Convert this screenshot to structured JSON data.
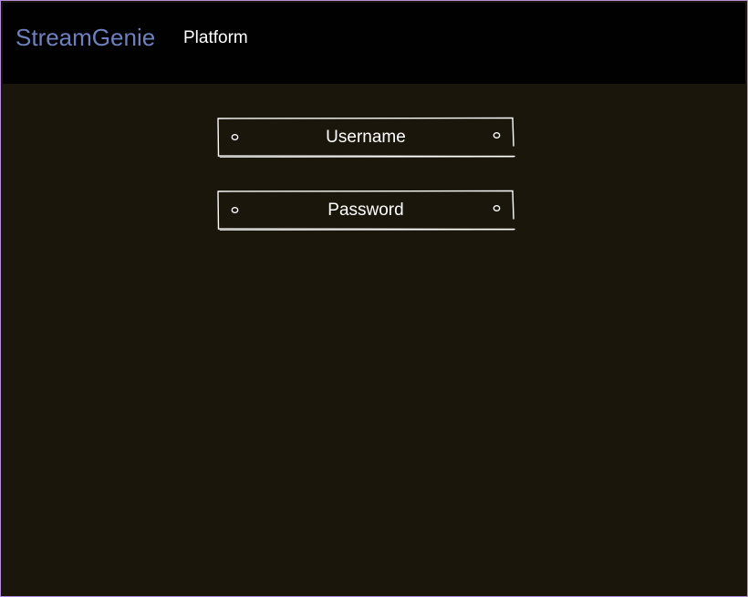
{
  "header": {
    "brand": "StreamGenie",
    "nav_link": "Platform"
  },
  "form": {
    "fields": [
      {
        "label": "Username"
      },
      {
        "label": "Password"
      }
    ]
  },
  "colors": {
    "header_bg": "#010101",
    "page_bg": "#1b160b",
    "brand": "#6f80be",
    "text": "#ffffff",
    "outline": "#ffffff"
  },
  "icons": {
    "field_left_marker": "circle-outline-icon",
    "field_right_marker": "circle-outline-icon"
  }
}
